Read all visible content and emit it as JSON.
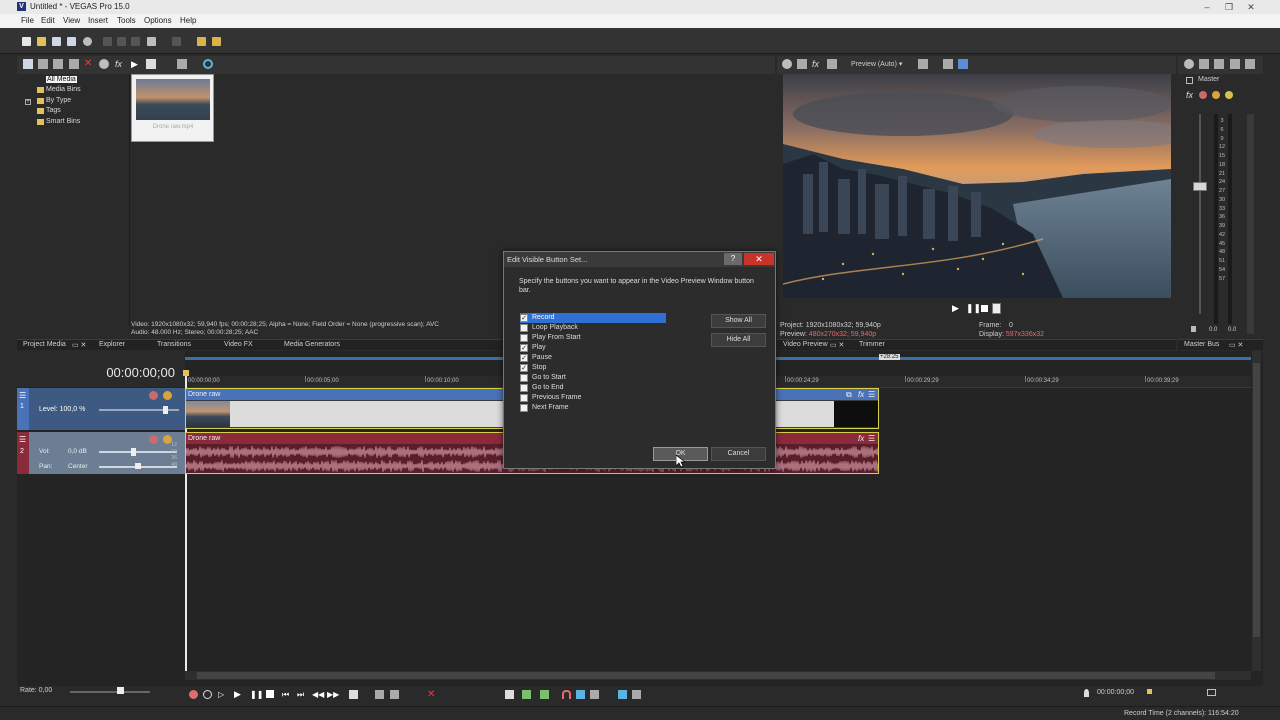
{
  "window": {
    "title": "Untitled * - VEGAS Pro 15.0",
    "app_letter": "V",
    "controls": [
      "–",
      "❐",
      "✕"
    ]
  },
  "menu": [
    "File",
    "Edit",
    "View",
    "Insert",
    "Tools",
    "Options",
    "Help"
  ],
  "project_media": {
    "tree": [
      "All Media",
      "Media Bins",
      "By Type",
      "Tags",
      "Smart Bins"
    ],
    "thumb_label": "Drone raw.mp4",
    "info_video": "Video: 1920x1080x32; 59,940 fps; 00:00:28;25; Alpha = None; Field Order = None (progressive scan); AVC",
    "info_audio": "Audio: 48.000 Hz; Stereo; 00:00:28;25; AAC"
  },
  "tabs_left": [
    "Project Media",
    "Explorer",
    "Transitions",
    "Video FX",
    "Media Generators"
  ],
  "preview": {
    "mode_label": "Preview (Auto)",
    "project_label": "Project:",
    "project_value": "1920x1080x32; 59,940p",
    "preview_label": "Preview:",
    "preview_value": "480x270x32; 59,940p",
    "frame_label": "Frame:",
    "frame_value": "0",
    "display_label": "Display:",
    "display_value": "597x336x32",
    "tabs": [
      "Video Preview",
      "Trimmer"
    ]
  },
  "master": {
    "title": "Master",
    "scale": [
      "3",
      "6",
      "9",
      "12",
      "15",
      "18",
      "21",
      "24",
      "27",
      "30",
      "33",
      "36",
      "39",
      "42",
      "45",
      "48",
      "51",
      "54",
      "57"
    ],
    "bottom_left": "0.0",
    "bottom_right": "0.0",
    "tab": "Master Bus"
  },
  "dialog": {
    "title": "Edit Visible Button Set...",
    "help": "?",
    "close": "✕",
    "instruction": "Specify the buttons you want to appear in the Video Preview Window button bar.",
    "items": [
      {
        "label": "Record",
        "checked": true,
        "selected": true
      },
      {
        "label": "Loop Playback",
        "checked": false,
        "selected": false
      },
      {
        "label": "Play From Start",
        "checked": false,
        "selected": false
      },
      {
        "label": "Play",
        "checked": true,
        "selected": false
      },
      {
        "label": "Pause",
        "checked": true,
        "selected": false
      },
      {
        "label": "Stop",
        "checked": true,
        "selected": false
      },
      {
        "label": "Go to Start",
        "checked": false,
        "selected": false
      },
      {
        "label": "Go to End",
        "checked": false,
        "selected": false
      },
      {
        "label": "Previous Frame",
        "checked": false,
        "selected": false
      },
      {
        "label": "Next Frame",
        "checked": false,
        "selected": false
      }
    ],
    "show_all": "Show All",
    "hide_all": "Hide All",
    "ok": "OK",
    "cancel": "Cancel"
  },
  "timeline": {
    "timecode": "00:00:00;00",
    "end_marker": "+28:25",
    "ruler": [
      "00:00:00;00",
      "00:00:05;00",
      "00:00:10;00",
      "00:00:24;29",
      "00:00:29;29",
      "00:00:34;29",
      "00:00:39;29"
    ],
    "video_track": {
      "number": "1",
      "level_label": "Level: 100,0 %",
      "clip_name": "Drone raw"
    },
    "audio_track": {
      "number": "2",
      "vol_label": "Vol:",
      "vol_value": "0,0 dB",
      "pan_label": "Pan:",
      "pan_value": "Center",
      "clip_name": "Drone raw",
      "meter": [
        "12",
        "24",
        "36",
        "48"
      ]
    }
  },
  "status": {
    "rate": "Rate: 0,00",
    "timecode": "00:00:00;00",
    "record_time": "Record Time (2 channels): 116:54:20"
  },
  "colors": {
    "video_clip_header": "#4a72b8",
    "audio_clip_header": "#8b2a3a",
    "dialog_selection": "#2f6fd6",
    "close_button": "#c9342a"
  }
}
